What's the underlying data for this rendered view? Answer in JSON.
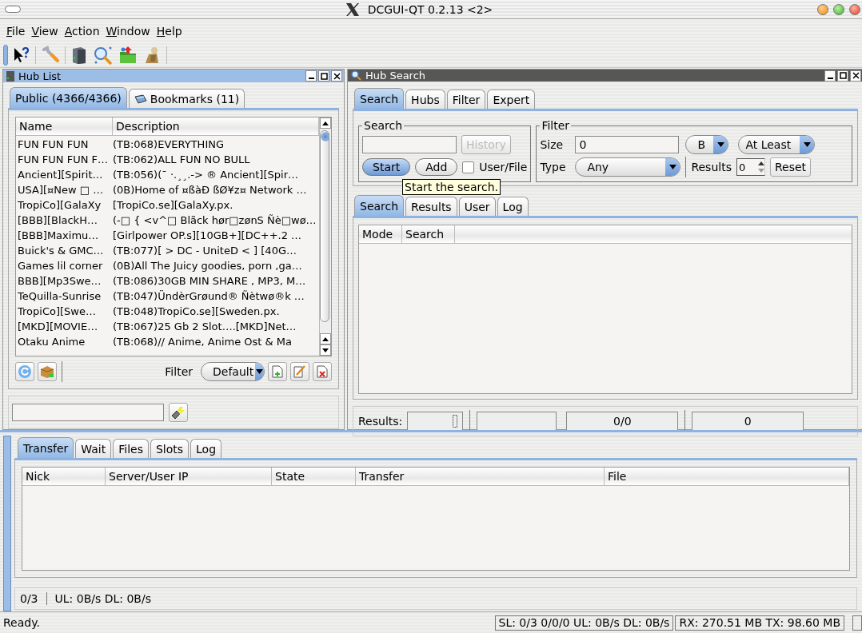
{
  "window": {
    "title": "DCGUI-QT 0.2.13 <2>"
  },
  "menu": [
    "File",
    "View",
    "Action",
    "Window",
    "Help"
  ],
  "hub_list": {
    "title": "Hub List",
    "tabs": [
      {
        "label": "Public (4366/4366)",
        "selected": true
      },
      {
        "label": "Bookmarks (11)",
        "selected": false
      }
    ],
    "columns": [
      "Name",
      "Description"
    ],
    "rows": [
      [
        "FUN FUN FUN",
        "(TB:068)EVERYTHING"
      ],
      [
        "FUN FUN FUN F…",
        "(TB:062)ALL FUN NO BULL"
      ],
      [
        "Ancient][Spirit…",
        "(TB:056)(¯ ·.¸¸.-> ® Ancient][Spir…"
      ],
      [
        "USA][¤New □ …",
        "(0B)Home of ¤ßàÐ ßØ¥z¤ Network …"
      ],
      [
        "TropiCo][GalaXy",
        "[TropiCo.se][GalaXy.px."
      ],
      [
        "[BBB][BlackH…",
        "(-□ { <v^□ Blãck hør□zønS Ñè□wø…"
      ],
      [
        "[BBB]Maximu…",
        "[Girlpower OP.s][10GB+][DC++.2 …"
      ],
      [
        "Buick's & GMC…",
        "(TB:077)[ > DC - UniteD < ] [40G…"
      ],
      [
        "Games lil corner",
        "(0B)All The Juicy goodies, porn ,ga…"
      ],
      [
        "BBB][Mp3Swe…",
        "(TB:086)30GB MIN SHARE , MP3, M…"
      ],
      [
        "TeQuilla-Sunrise",
        "(TB:047)ÜndèrGrøund® Ñètwø®k …"
      ],
      [
        "TropiCo][Swe…",
        "(TB:048)TropiCo.se][Sweden.px."
      ],
      [
        "[MKD][MOVIE…",
        "(TB:067)25 Gb 2 Slot….[MKD]Net…"
      ],
      [
        "Otaku Anime",
        "(TB:068)// Anime, Anime Ost & Ma"
      ]
    ],
    "filter_label": "Filter",
    "filter_value": "Default"
  },
  "hub_search": {
    "title": "Hub Search",
    "tabs": [
      {
        "label": "Search",
        "selected": true
      },
      {
        "label": "Hubs",
        "selected": false
      },
      {
        "label": "Filter",
        "selected": false
      },
      {
        "label": "Expert",
        "selected": false
      }
    ],
    "search_group": {
      "title": "Search",
      "history": {
        "label": "History",
        "disabled": true
      },
      "start": "Start",
      "add": "Add",
      "user_file": {
        "label": "User/File",
        "checked": false
      }
    },
    "filter_group": {
      "title": "Filter",
      "size_label": "Size",
      "size_value": "0",
      "unit": "B",
      "mode": "At Least",
      "type_label": "Type",
      "type_value": "Any",
      "results_label": "Results",
      "results_value": "0",
      "reset": "Reset"
    },
    "tooltip": "Start the search.",
    "result_tabs": [
      {
        "label": "Search",
        "selected": true
      },
      {
        "label": "Results",
        "selected": false
      },
      {
        "label": "User",
        "selected": false
      },
      {
        "label": "Log",
        "selected": false
      }
    ],
    "columns": [
      "Mode",
      "Search"
    ],
    "status": {
      "label": "Results:",
      "count": "0/0",
      "total": "0"
    }
  },
  "transfers": {
    "tabs": [
      {
        "label": "Transfer",
        "selected": true
      },
      {
        "label": "Wait",
        "selected": false
      },
      {
        "label": "Files",
        "selected": false
      },
      {
        "label": "Slots",
        "selected": false
      },
      {
        "label": "Log",
        "selected": false
      }
    ],
    "columns": [
      "Nick",
      "Server/User IP",
      "State",
      "Transfer",
      "File"
    ],
    "slots": "0/3",
    "rates": "UL: 0B/s DL: 0B/s"
  },
  "status_bar": {
    "message": "Ready.",
    "slots": "SL: 0/3 0/0/0 UL: 0B/s DL: 0B/s",
    "traffic": "RX: 270.51 MB TX: 98.60 MB"
  }
}
